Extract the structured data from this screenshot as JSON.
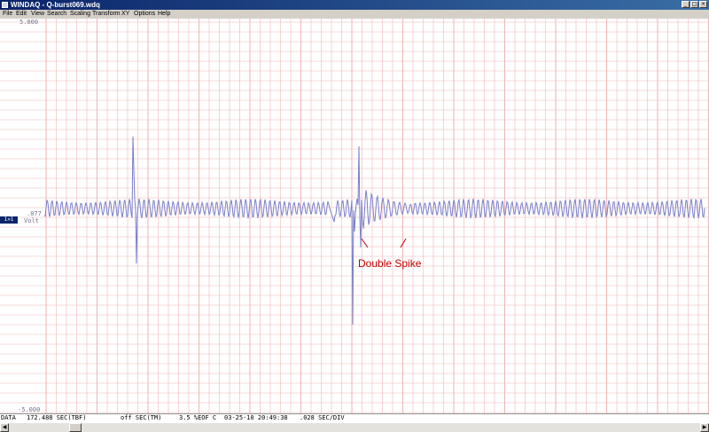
{
  "window": {
    "title": "WINDAQ - Q-burst069.wdq"
  },
  "menu": [
    "File",
    "Edit",
    "View",
    "Search",
    "Scaling",
    "Transform",
    "XY",
    "Options",
    "Help"
  ],
  "plot": {
    "ymax_label": "5.000",
    "ymin_label": "-5.000",
    "cursor_value": ".077",
    "unit": "Volt",
    "channel_tag": "1»1",
    "annotation": "Double Spike",
    "colors": {
      "grid": "#f0b8b8",
      "trace": "#7a7ec8",
      "annotation": "#c00000"
    }
  },
  "status": {
    "mode": "DATA",
    "time": "172.488 SEC(TBF)",
    "marker": "off SEC(TM)",
    "eof": "3.5 %EOF C",
    "timestamp": "03-25-10 20:49:38",
    "timebase": ".028 SEC/DIV"
  }
}
